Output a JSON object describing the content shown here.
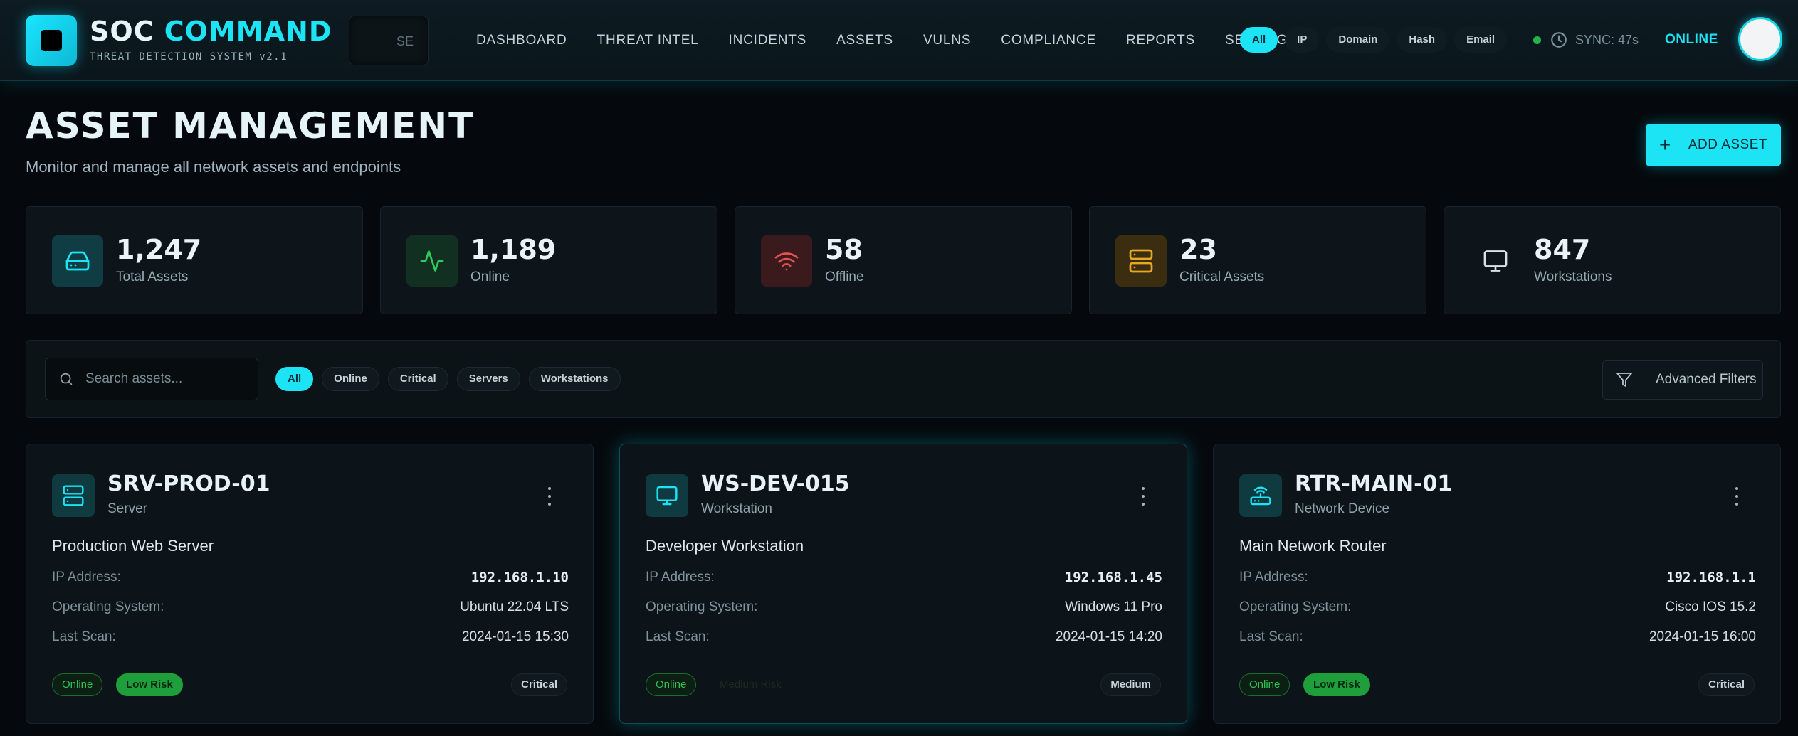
{
  "brand": {
    "title_part1": "SOC",
    "title_part2": "COMMAND",
    "subtitle": "THREAT DETECTION SYSTEM v2.1"
  },
  "topbar": {
    "search_text": "SE",
    "nav": [
      "DASHBOARD",
      "THREAT INTEL",
      "INCIDENTS",
      "ASSETS",
      "VULNS",
      "COMPLIANCE",
      "REPORTS",
      "SETTINGS"
    ],
    "type_filters": [
      "All",
      "IP",
      "Domain",
      "Hash",
      "Email"
    ],
    "type_filter_active": "All",
    "sync": "SYNC: 47s",
    "status": "ONLINE"
  },
  "header": {
    "title": "ASSET MANAGEMENT",
    "subtitle": "Monitor and manage all network assets and endpoints",
    "add_button": "ADD ASSET"
  },
  "stats": [
    {
      "value": "1,247",
      "label": "Total Assets",
      "icon": "hard-drive-icon",
      "color": "#1de4f5"
    },
    {
      "value": "1,189",
      "label": "Online",
      "icon": "activity-icon",
      "color": "#2ecc5a"
    },
    {
      "value": "58",
      "label": "Offline",
      "icon": "wifi-icon",
      "color": "#e2524f"
    },
    {
      "value": "23",
      "label": "Critical Assets",
      "icon": "server-icon",
      "color": "#e5a826"
    },
    {
      "value": "847",
      "label": "Workstations",
      "icon": "monitor-icon",
      "color": "#d7e3e8"
    }
  ],
  "filters": {
    "search_placeholder": "Search assets...",
    "chips": [
      "All",
      "Online",
      "Critical",
      "Servers",
      "Workstations"
    ],
    "active_chip": "All",
    "advanced": "Advanced Filters"
  },
  "labels": {
    "ip": "IP Address:",
    "os": "Operating System:",
    "last_scan": "Last Scan:"
  },
  "assets": [
    {
      "name": "SRV-PROD-01",
      "type": "Server",
      "icon": "server-icon",
      "description": "Production Web Server",
      "ip": "192.168.1.10",
      "os": "Ubuntu 22.04 LTS",
      "last_scan": "2024-01-15 15:30",
      "status": "Online",
      "risk": "Low Risk",
      "severity": "Critical"
    },
    {
      "name": "WS-DEV-015",
      "type": "Workstation",
      "icon": "monitor-icon",
      "description": "Developer Workstation",
      "ip": "192.168.1.45",
      "os": "Windows 11 Pro",
      "last_scan": "2024-01-15 14:20",
      "status": "Online",
      "risk": "Medium Risk",
      "severity": "Medium"
    },
    {
      "name": "RTR-MAIN-01",
      "type": "Network Device",
      "icon": "router-icon",
      "description": "Main Network Router",
      "ip": "192.168.1.1",
      "os": "Cisco IOS 15.2",
      "last_scan": "2024-01-15 16:00",
      "status": "Online",
      "risk": "Low Risk",
      "severity": "Critical"
    }
  ]
}
